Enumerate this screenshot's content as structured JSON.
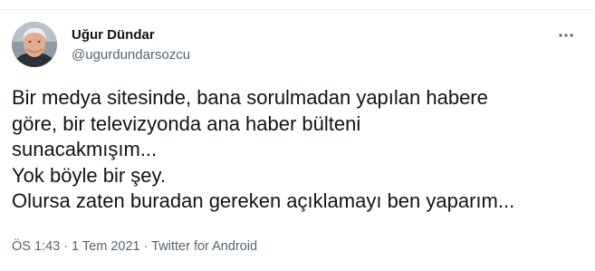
{
  "tweet": {
    "author": {
      "name": "Uğur Dündar",
      "handle": "@ugurdundarsozcu",
      "avatar_icon": "profile-photo"
    },
    "more_icon": "more-options-icon",
    "text": "Bir medya sitesinde, bana sorulmadan yapılan habere\ngöre, bir televizyonda ana haber bülteni\nsunacakmışım...\nYok böyle bir şey.\nOlursa zaten buradan gereken açıklamayı ben yaparım...",
    "meta": {
      "time": "ÖS 1:43",
      "separator1": " · ",
      "date": "1 Tem 2021",
      "separator2": " · ",
      "source": "Twitter for Android"
    }
  },
  "colors": {
    "text_primary": "#0f1419",
    "text_secondary": "#536471",
    "divider": "#ebeef0"
  }
}
